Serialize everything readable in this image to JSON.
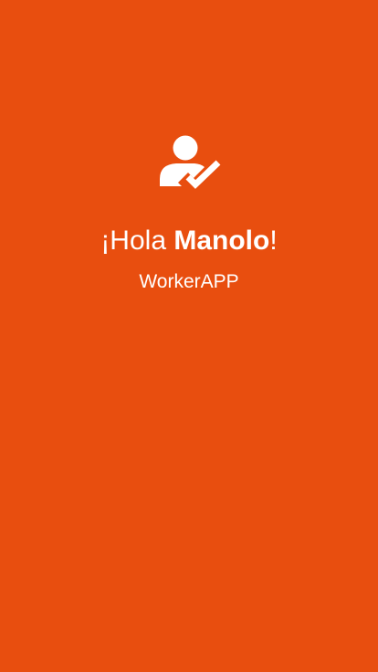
{
  "colors": {
    "background": "#E84E0F",
    "foreground": "#FFFFFF"
  },
  "icon": "user-check-icon",
  "greeting": {
    "prefix": "¡Hola ",
    "name": "Manolo",
    "suffix": "!"
  },
  "app_name": "WorkerAPP"
}
